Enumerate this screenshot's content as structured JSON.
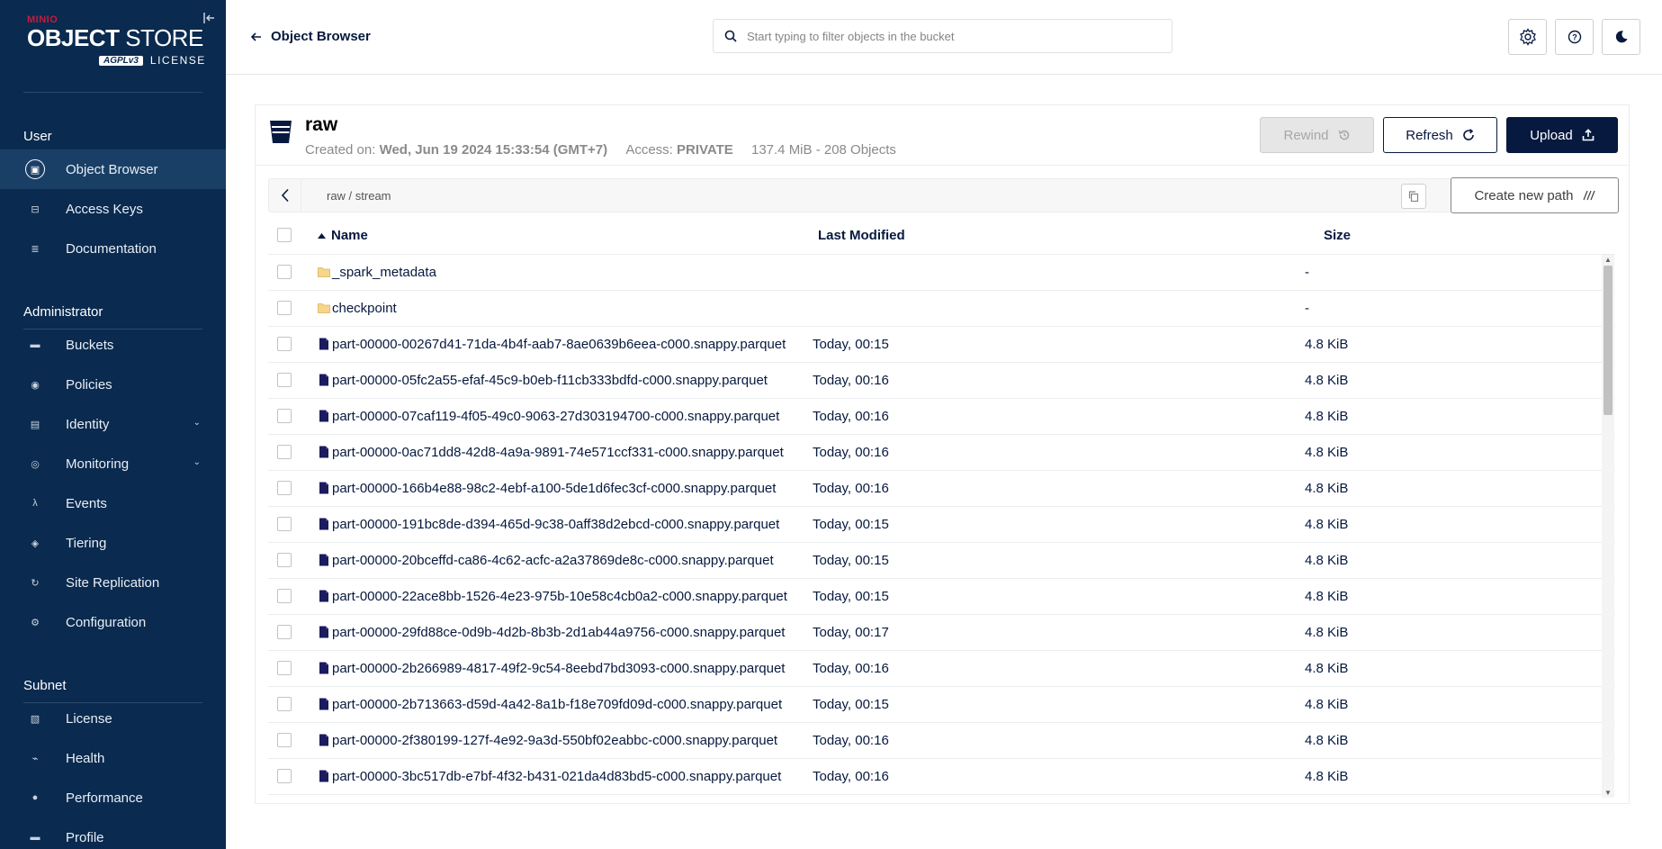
{
  "colors": {
    "sidebar_bg": "#0a2a4f",
    "sidebar_active": "#1a3f66",
    "primary": "#07193e",
    "brand_red": "#c51c3f"
  },
  "logo": {
    "brand": "MINIO",
    "product_bold": "OBJECT",
    "product_thin": " STORE",
    "badge": "AGPLv3",
    "license": "LICENSE"
  },
  "sidebar": {
    "sections": [
      {
        "title": "User",
        "items": [
          {
            "label": "Object Browser",
            "icon": "object-browser-icon",
            "active": true
          },
          {
            "label": "Access Keys",
            "icon": "access-keys-icon"
          },
          {
            "label": "Documentation",
            "icon": "documentation-icon"
          }
        ]
      },
      {
        "title": "Administrator",
        "items": [
          {
            "label": "Buckets",
            "icon": "bucket-icon"
          },
          {
            "label": "Policies",
            "icon": "policies-icon"
          },
          {
            "label": "Identity",
            "icon": "identity-icon",
            "expandable": true
          },
          {
            "label": "Monitoring",
            "icon": "monitoring-icon",
            "expandable": true
          },
          {
            "label": "Events",
            "icon": "lambda-icon"
          },
          {
            "label": "Tiering",
            "icon": "tiering-icon"
          },
          {
            "label": "Site Replication",
            "icon": "site-replication-icon"
          },
          {
            "label": "Configuration",
            "icon": "gear-icon"
          }
        ]
      },
      {
        "title": "Subnet",
        "items": [
          {
            "label": "License",
            "icon": "license-icon"
          },
          {
            "label": "Health",
            "icon": "health-icon"
          },
          {
            "label": "Performance",
            "icon": "performance-icon"
          },
          {
            "label": "Profile",
            "icon": "profile-icon"
          }
        ]
      }
    ]
  },
  "header": {
    "back_label": "Object Browser",
    "search_placeholder": "Start typing to filter objects in the bucket"
  },
  "bucket": {
    "name": "raw",
    "created_label": "Created on:",
    "created_value": "Wed, Jun 19 2024 15:33:54 (GMT+7)",
    "access_label": "Access:",
    "access_value": "PRIVATE",
    "usage": "137.4 MiB - 208 Objects"
  },
  "actions": {
    "rewind": "Rewind",
    "refresh": "Refresh",
    "upload": "Upload",
    "create_path": "Create new path"
  },
  "path": {
    "crumbs": "raw / stream"
  },
  "table": {
    "columns": {
      "name": "Name",
      "modified": "Last Modified",
      "size": "Size"
    },
    "rows": [
      {
        "type": "folder",
        "name": "_spark_metadata",
        "modified": "",
        "size": "-"
      },
      {
        "type": "folder",
        "name": "checkpoint",
        "modified": "",
        "size": "-"
      },
      {
        "type": "file",
        "name": "part-00000-00267d41-71da-4b4f-aab7-8ae0639b6eea-c000.snappy.parquet",
        "modified": "Today, 00:15",
        "size": "4.8 KiB"
      },
      {
        "type": "file",
        "name": "part-00000-05fc2a55-efaf-45c9-b0eb-f11cb333bdfd-c000.snappy.parquet",
        "modified": "Today, 00:16",
        "size": "4.8 KiB"
      },
      {
        "type": "file",
        "name": "part-00000-07caf119-4f05-49c0-9063-27d303194700-c000.snappy.parquet",
        "modified": "Today, 00:16",
        "size": "4.8 KiB"
      },
      {
        "type": "file",
        "name": "part-00000-0ac71dd8-42d8-4a9a-9891-74e571ccf331-c000.snappy.parquet",
        "modified": "Today, 00:16",
        "size": "4.8 KiB"
      },
      {
        "type": "file",
        "name": "part-00000-166b4e88-98c2-4ebf-a100-5de1d6fec3cf-c000.snappy.parquet",
        "modified": "Today, 00:16",
        "size": "4.8 KiB"
      },
      {
        "type": "file",
        "name": "part-00000-191bc8de-d394-465d-9c38-0aff38d2ebcd-c000.snappy.parquet",
        "modified": "Today, 00:15",
        "size": "4.8 KiB"
      },
      {
        "type": "file",
        "name": "part-00000-20bceffd-ca86-4c62-acfc-a2a37869de8c-c000.snappy.parquet",
        "modified": "Today, 00:15",
        "size": "4.8 KiB"
      },
      {
        "type": "file",
        "name": "part-00000-22ace8bb-1526-4e23-975b-10e58c4cb0a2-c000.snappy.parquet",
        "modified": "Today, 00:15",
        "size": "4.8 KiB"
      },
      {
        "type": "file",
        "name": "part-00000-29fd88ce-0d9b-4d2b-8b3b-2d1ab44a9756-c000.snappy.parquet",
        "modified": "Today, 00:17",
        "size": "4.8 KiB"
      },
      {
        "type": "file",
        "name": "part-00000-2b266989-4817-49f2-9c54-8eebd7bd3093-c000.snappy.parquet",
        "modified": "Today, 00:16",
        "size": "4.8 KiB"
      },
      {
        "type": "file",
        "name": "part-00000-2b713663-d59d-4a42-8a1b-f18e709fd09d-c000.snappy.parquet",
        "modified": "Today, 00:15",
        "size": "4.8 KiB"
      },
      {
        "type": "file",
        "name": "part-00000-2f380199-127f-4e92-9a3d-550bf02eabbc-c000.snappy.parquet",
        "modified": "Today, 00:16",
        "size": "4.8 KiB"
      },
      {
        "type": "file",
        "name": "part-00000-3bc517db-e7bf-4f32-b431-021da4d83bd5-c000.snappy.parquet",
        "modified": "Today, 00:16",
        "size": "4.8 KiB"
      }
    ]
  }
}
